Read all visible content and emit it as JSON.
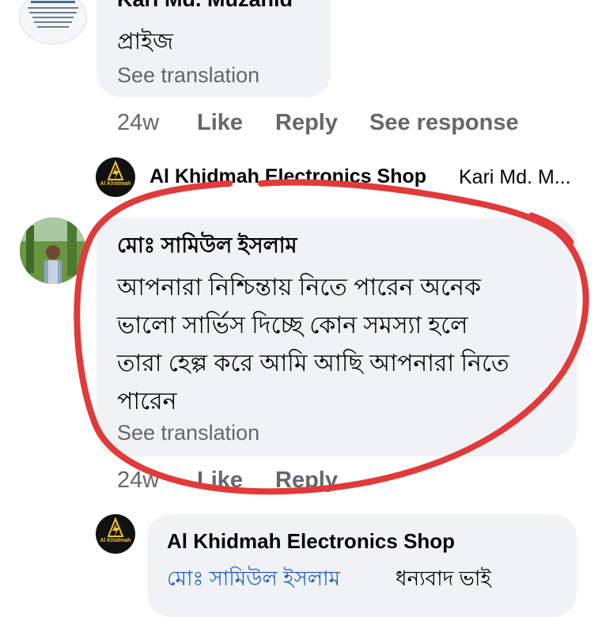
{
  "top_comment": {
    "author": "Kari Md. Muzahid",
    "text": "প্রাইজ",
    "see_translation": "See translation",
    "time": "24w",
    "like": "Like",
    "reply": "Reply",
    "see_response": "See response"
  },
  "shop_reply_collapsed": {
    "author": "Al Khidmah Electronics Shop",
    "mention_preview": "Kari Md. M...",
    "logo_text": "Al Khidmah"
  },
  "main_comment": {
    "author": "মোঃ সামিউল ইসলাম",
    "lines": [
      "আপনারা নিশ্চিন্তায় নিতে পারেন অনেক",
      "ভালো সার্ভিস দিচ্ছে  কোন সমস্যা হলে",
      "তারা হেল্প করে আমি আছি আপনারা নিতে",
      "পারেন"
    ],
    "see_translation": "See translation",
    "time": "24w",
    "like": "Like",
    "reply": "Reply"
  },
  "shop_reply": {
    "author": "Al Khidmah Electronics Shop",
    "mention": "মোঃ সামিউল ইসলাম",
    "text": "ধন্যবাদ ভাই",
    "logo_text": "Al Khidmah"
  },
  "colors": {
    "bubble": "#f0f2f5",
    "secondary_text": "#65676b",
    "mention": "#1d65c1",
    "annotation_circle": "#e03a3a"
  }
}
